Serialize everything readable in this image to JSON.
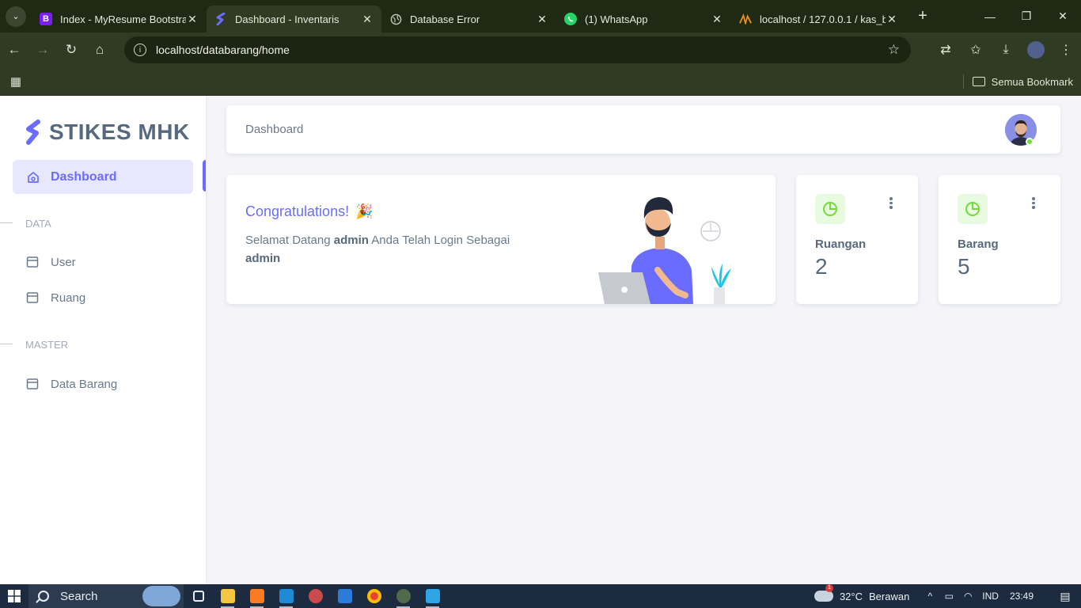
{
  "browser": {
    "tabs": [
      {
        "title": "Index - MyResume Bootstrap",
        "favicon": "bootstrap-icon",
        "favicon_color": "#7a1ef5"
      },
      {
        "title": "Dashboard - Inventaris",
        "favicon": "sneat-logo-icon",
        "favicon_color": "#696cff",
        "active": true
      },
      {
        "title": "Database Error",
        "favicon": "globe-icon",
        "favicon_color": "#c5cabb"
      },
      {
        "title": "(1) WhatsApp",
        "favicon": "whatsapp-icon",
        "favicon_color": "#25d366"
      },
      {
        "title": "localhost / 127.0.0.1 / kas_b",
        "favicon": "phpmyadmin-icon",
        "favicon_color": "#f29111"
      }
    ],
    "address": "localhost/databarang/home",
    "bookmarks_label": "Semua Bookmark"
  },
  "sidebar": {
    "brand": "STIKES MHK",
    "active_item": "Dashboard",
    "sections": [
      {
        "header": "DATA",
        "items": [
          "User",
          "Ruang"
        ]
      },
      {
        "header": "MASTER",
        "items": [
          "Data Barang"
        ]
      }
    ]
  },
  "topbar": {
    "title": "Dashboard"
  },
  "welcome": {
    "heading": "Congratulations!",
    "emoji": "🎉",
    "text_before": "Selamat Datang",
    "username": "admin",
    "text_middle": "Anda Telah Login Sebagai",
    "role": "admin"
  },
  "stats": [
    {
      "label": "Ruangan",
      "value": "2"
    },
    {
      "label": "Barang",
      "value": "5"
    }
  ],
  "colors": {
    "primary": "#696cff",
    "success": "#71dd37",
    "text": "#566a7f"
  },
  "taskbar": {
    "search_label": "Search",
    "weather_temp": "32°C",
    "weather_text": "Berawan",
    "weather_badge": "1",
    "language": "IND",
    "time": "23:49"
  }
}
